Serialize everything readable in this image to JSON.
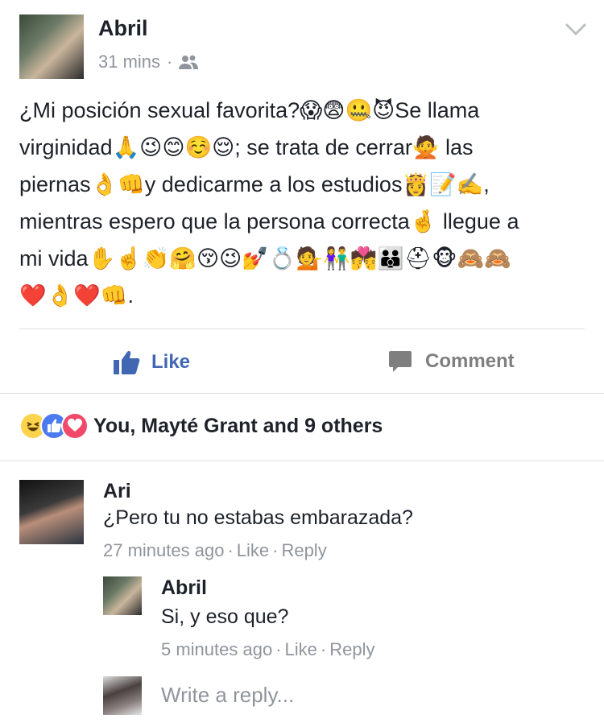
{
  "post": {
    "author": "Abril",
    "time": "31 mins",
    "separator": "·",
    "audience_icon": "friends-icon",
    "menu_icon": "chevron-down-icon",
    "lines": [
      "¿Mi posición sexual favorita?😱😨🤐😈Se llama",
      "virginidad🙏😉😊☺️😌; se trata de cerrar🙅 las",
      "piernas👌👊y dedicarme a los estudios👸📝✍️,",
      "mientras espero que la persona correcta🤞 llegue a",
      "mi vida✋☝️👏🤗😚😉💅💍💁👫💏👪⛑🐵🙈🙈",
      "❤️👌❤️👊."
    ]
  },
  "actions": {
    "like_label": "Like",
    "comment_label": "Comment",
    "like_icon": "thumbs-up-icon",
    "comment_icon": "comment-bubble-icon"
  },
  "reactions": {
    "icons": [
      "haha-reaction-icon",
      "like-reaction-icon",
      "love-reaction-icon"
    ],
    "summary": "You, Mayté Grant and 9 others"
  },
  "comments": [
    {
      "author": "Ari",
      "text": "¿Pero tu no estabas embarazada?",
      "time": "27 minutes ago",
      "like": "Like",
      "reply": "Reply"
    }
  ],
  "reply": {
    "author": "Abril",
    "text": "Si, y eso que?",
    "time": "5 minutes ago",
    "like": "Like",
    "reply": "Reply"
  },
  "reply_box": {
    "placeholder": "Write a reply..."
  },
  "colors": {
    "accent": "#4267b2",
    "muted": "#90949c",
    "haha": "#fcd34d",
    "like": "#4c7bf0",
    "love": "#f0496a"
  }
}
